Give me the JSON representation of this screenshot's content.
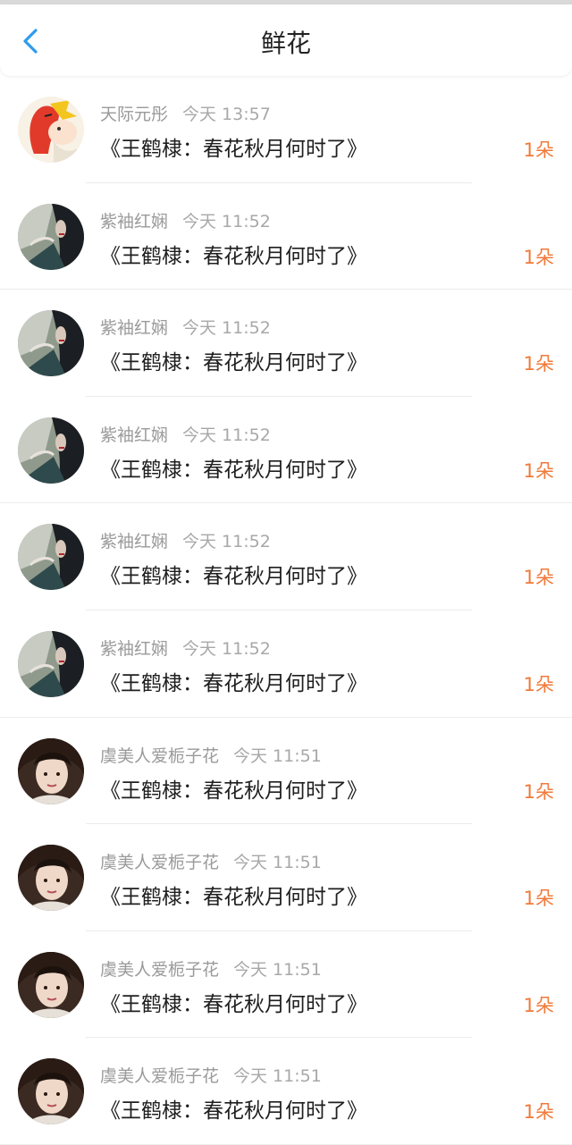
{
  "header": {
    "title": "鲜花",
    "back_icon": "chevron-left-icon",
    "accent_color": "#2d9cf0"
  },
  "items": [
    {
      "user": "天际元彤",
      "time": "今天 13:57",
      "work": "《王鹤棣：春花秋月何时了》",
      "count": "1朵",
      "avatar_style": "cartoon"
    },
    {
      "user": "紫袖红娴",
      "time": "今天 11:52",
      "work": "《王鹤棣：春花秋月何时了》",
      "count": "1朵",
      "avatar_style": "dark"
    },
    {
      "user": "紫袖红娴",
      "time": "今天 11:52",
      "work": "《王鹤棣：春花秋月何时了》",
      "count": "1朵",
      "avatar_style": "dark"
    },
    {
      "user": "紫袖红娴",
      "time": "今天 11:52",
      "work": "《王鹤棣：春花秋月何时了》",
      "count": "1朵",
      "avatar_style": "dark"
    },
    {
      "user": "紫袖红娴",
      "time": "今天 11:52",
      "work": "《王鹤棣：春花秋月何时了》",
      "count": "1朵",
      "avatar_style": "dark"
    },
    {
      "user": "紫袖红娴",
      "time": "今天 11:52",
      "work": "《王鹤棣：春花秋月何时了》",
      "count": "1朵",
      "avatar_style": "dark"
    },
    {
      "user": "虞美人爱栀子花",
      "time": "今天 11:51",
      "work": "《王鹤棣：春花秋月何时了》",
      "count": "1朵",
      "avatar_style": "portrait"
    },
    {
      "user": "虞美人爱栀子花",
      "time": "今天 11:51",
      "work": "《王鹤棣：春花秋月何时了》",
      "count": "1朵",
      "avatar_style": "portrait"
    },
    {
      "user": "虞美人爱栀子花",
      "time": "今天 11:51",
      "work": "《王鹤棣：春花秋月何时了》",
      "count": "1朵",
      "avatar_style": "portrait"
    },
    {
      "user": "虞美人爱栀子花",
      "time": "今天 11:51",
      "work": "《王鹤棣：春花秋月何时了》",
      "count": "1朵",
      "avatar_style": "portrait"
    }
  ],
  "colors": {
    "count": "#f07a3a",
    "meta": "#9a9a9a",
    "divider": "#ececec"
  }
}
